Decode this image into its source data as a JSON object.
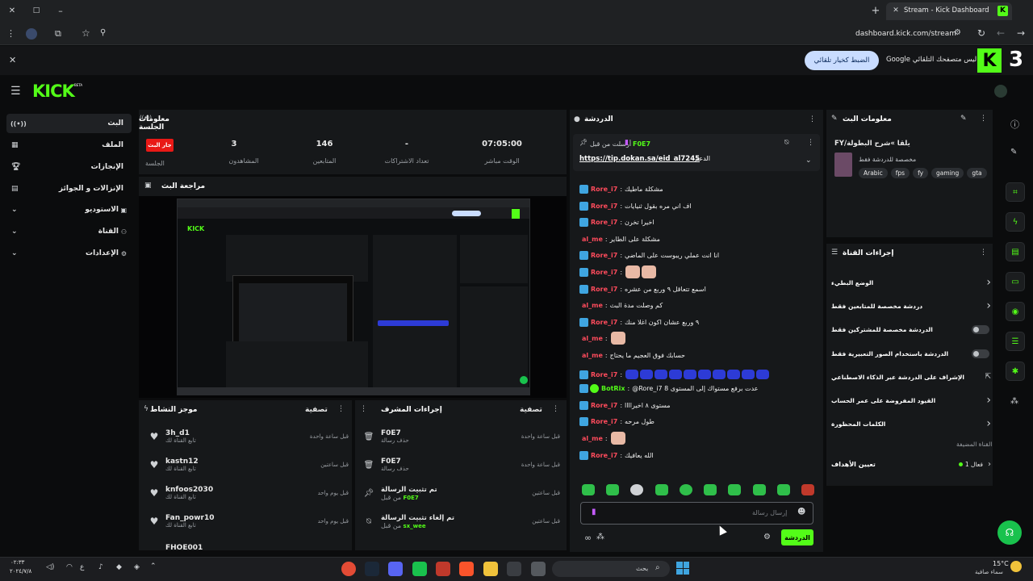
{
  "browser": {
    "tab_title": "Stream - Kick Dashboard",
    "tab_badge": "K",
    "url": "dashboard.kick.com/stream",
    "new_tab": "+",
    "close_tab": "✕"
  },
  "translate_bar": {
    "message": "Google ليس متصفحك التلقائي",
    "button": "الضبط كخيار تلقائي",
    "logo_number": "3"
  },
  "header": {
    "logo": "KICK",
    "logo_beta": "BETA"
  },
  "left_nav": {
    "items": [
      {
        "label": "البث",
        "icon": "live-icon"
      },
      {
        "label": "الملف",
        "icon": "grid-icon"
      },
      {
        "label": "الإنجازات",
        "icon": "trophy-icon"
      },
      {
        "label": "الإنزالات و الجوائز",
        "icon": "gift-icon"
      },
      {
        "label": "الاستوديو",
        "icon": "studio-icon"
      },
      {
        "label": "القناة",
        "icon": "people-icon"
      },
      {
        "label": "الإعدادات",
        "icon": "gear-icon"
      }
    ]
  },
  "session": {
    "title": "معلومات الجلسة",
    "live_badge": "جار البث",
    "session_label": "الجلسة",
    "stats": [
      {
        "value": "07:05:00",
        "label": "الوقت مباشر"
      },
      {
        "value": "-",
        "label": "تعداد الاشتراكات"
      },
      {
        "value": "146",
        "label": "المتابعين"
      },
      {
        "value": "3",
        "label": "المشاهدون"
      }
    ]
  },
  "preview": {
    "title": "مراجعة البث"
  },
  "activity": {
    "title": "موجز النشاط",
    "filter": "تصفية",
    "items": [
      {
        "user": "3h_d1",
        "sub": "تابع القناة لك",
        "time": "قبل ساعة واحدة"
      },
      {
        "user": "kastn12",
        "sub": "تابع القناة لك",
        "time": "قبل ساعتين"
      },
      {
        "user": "knfoos2030",
        "sub": "تابع القناة لك",
        "time": "قبل يوم واحد"
      },
      {
        "user": "Fan_powr10",
        "sub": "تابع القناة لك",
        "time": "قبل يوم واحد"
      },
      {
        "user": "FHOE001",
        "sub": "",
        "time": ""
      }
    ]
  },
  "mod_actions": {
    "title": "إجراءات المشرف",
    "filter": "تصفية",
    "items": [
      {
        "title": "F0E7",
        "sub": "حذف رسالة",
        "time": "قبل ساعة واحدة",
        "user": ""
      },
      {
        "title": "F0E7",
        "sub": "حذف رسالة",
        "time": "قبل ساعة واحدة",
        "user": ""
      },
      {
        "title": "تم تثبيت الرسالة",
        "sub": "من قبل",
        "time": "قبل ساعتين",
        "user": "F0E7"
      },
      {
        "title": "تم إلغاء تثبيت الرسالة",
        "sub": "من قبل",
        "time": "قبل ساعتين",
        "user": "sx_wee"
      }
    ]
  },
  "chat": {
    "title": "الدردشة",
    "pinned_by": "أرسلت من قبل",
    "pinned_user": "F0E7",
    "pinned_link": "https://tip.dokan.sa/eid_al7245",
    "pinned_label": "الدعم",
    "messages": [
      {
        "user": "Rore_i7",
        "text": "مشكلة ماطيك",
        "color": "r"
      },
      {
        "user": "Rore_i7",
        "text": "اف اني مره بقول ثنيايات",
        "color": "r"
      },
      {
        "user": "Rore_i7",
        "text": "اخيرا تخرن",
        "color": "r"
      },
      {
        "user": "al_me",
        "text": "مشكلة على الطاير",
        "color": "r"
      },
      {
        "user": "Rore_i7",
        "text": "انا انت عملي ريبوست على الماضي",
        "color": "r"
      },
      {
        "user": "Rore_i7",
        "text": "",
        "color": "r"
      },
      {
        "user": "Rore_i7",
        "text": "اسمع تتعاقل ٩ وربع من عشره",
        "color": "r"
      },
      {
        "user": "al_me",
        "text": "كم وصلت مدة البث",
        "color": "r"
      },
      {
        "user": "Rore_i7",
        "text": "٩ وربع عشان اكون اغلا منك",
        "color": "r"
      },
      {
        "user": "al_me",
        "text": "",
        "color": "r"
      },
      {
        "user": "al_me",
        "text": "حسابك فوق العجيم ما يحتاج",
        "color": "r"
      },
      {
        "user": "Rore_i7",
        "text": "",
        "color": "r"
      },
      {
        "user": "BotRix",
        "text": "@Rore_i7 عدت برفع مستواك إلى المستوى 8",
        "color": "g"
      },
      {
        "user": "Rore_i7",
        "text": "مستوى ٨ اخيراااا",
        "color": "r"
      },
      {
        "user": "Rore_i7",
        "text": "طول مرحه",
        "color": "r"
      },
      {
        "user": "al_me",
        "text": "",
        "color": "r"
      },
      {
        "user": "Rore_i7",
        "text": "الله يعافيك",
        "color": "r"
      }
    ],
    "input_placeholder": "إرسال رسالة",
    "send_button": "الدردشة"
  },
  "stream_info": {
    "title": "معلومات البث",
    "stream_title": "FY/يلقا »شرح البطولة",
    "category": "مخصصة للدردشة فقط",
    "tags": [
      "Arabic",
      "fps",
      "fy",
      "gaming",
      "gta"
    ]
  },
  "channel_actions": {
    "title": "إجراءات القناة",
    "items": [
      {
        "label": "الوضع البطيء",
        "type": "chevron"
      },
      {
        "label": "دردشة مخصصة للمتابعين فقط",
        "type": "chevron"
      },
      {
        "label": "الدردشة مخصصة للمشتركين فقط",
        "type": "toggle"
      },
      {
        "label": "الدردشة باستخدام الصور التعبيرية فقط",
        "type": "toggle"
      },
      {
        "label": "الإشراف على الدردشة عبر الذكاء الاصطناعي",
        "type": "external"
      },
      {
        "label": "القيود المفروضة على عمر الحساب",
        "type": "chevron"
      },
      {
        "label": "الكلمات المحظورة",
        "type": "chevron"
      }
    ],
    "goals_section": "القناة المضيفة",
    "goals_label": "تعيين الأهداف",
    "goals_status": "فعال 1"
  },
  "taskbar": {
    "search": "بحث",
    "temp": "15°C",
    "weather": "سماء صافية",
    "time": "٠٢:٣٣",
    "date": "٢٠٢٤/٧/٨"
  },
  "colors": {
    "accent": "#53fc18",
    "live": "#e91916",
    "username": "#ff4b5c"
  }
}
